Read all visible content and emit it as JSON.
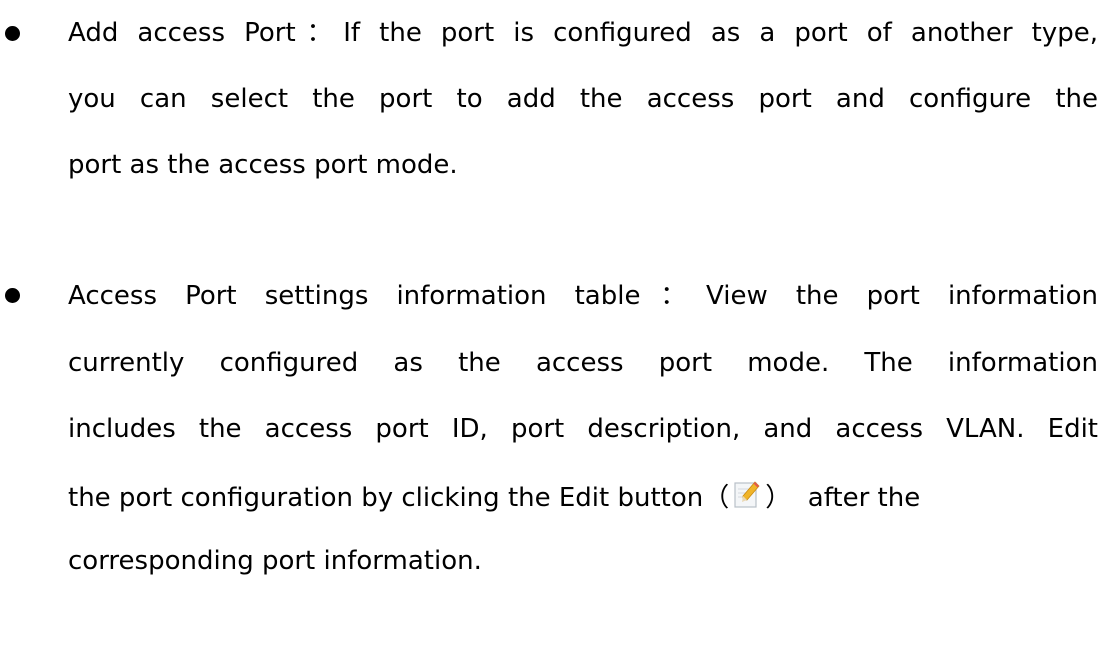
{
  "items": [
    {
      "lines": [
        "Add access Port：If the port is configured as a port of another type,",
        "you can select the port to add the access port and configure the",
        "port as the access port mode."
      ]
    },
    {
      "lines": [
        "Access Port settings information table：View the port information",
        "currently configured as the access port mode. The information",
        "includes the access port ID, port description, and access VLAN. Edit"
      ],
      "edit_line": {
        "before": "the port configuration by clicking the Edit button（",
        "icon": "edit-icon",
        "after": "）  after the"
      },
      "last_line": "corresponding port information."
    }
  ]
}
